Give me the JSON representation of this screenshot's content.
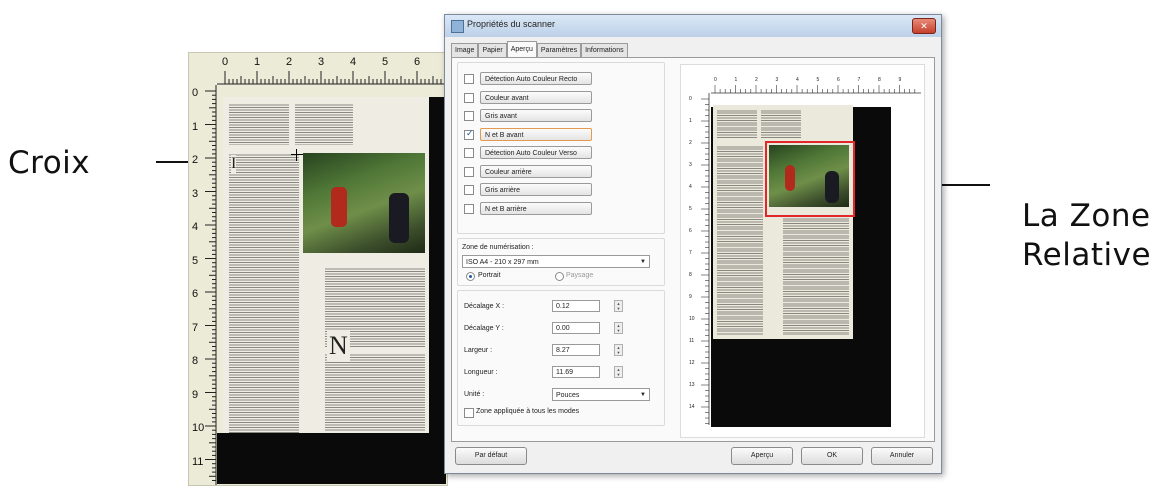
{
  "annotations": {
    "croix": "Croix",
    "zone_line1": "La Zone",
    "zone_line2": "Relative"
  },
  "left_preview": {
    "ruler_h": [
      "0",
      "1",
      "2",
      "3",
      "4",
      "5",
      "6"
    ],
    "ruler_v": [
      "0",
      "1",
      "2",
      "3",
      "4",
      "5",
      "6",
      "7",
      "8",
      "9",
      "10",
      "11"
    ]
  },
  "dialog": {
    "title": "Propriétés du scanner",
    "close_glyph": "✕",
    "tabs": [
      "Image",
      "Papier",
      "Aperçu",
      "Paramètres",
      "Informations"
    ],
    "options": [
      {
        "label": "Détection Auto Couleur Recto",
        "checked": false
      },
      {
        "label": "Couleur avant",
        "checked": false
      },
      {
        "label": "Gris avant",
        "checked": false
      },
      {
        "label": "N et B avant",
        "checked": true
      },
      {
        "label": "Détection Auto Couleur Verso",
        "checked": false
      },
      {
        "label": "Couleur arrière",
        "checked": false
      },
      {
        "label": "Gris arrière",
        "checked": false
      },
      {
        "label": "N et B arrière",
        "checked": false
      }
    ],
    "zone_label": "Zone de numérisation :",
    "zone_value": "ISO A4 - 210 x 297 mm",
    "portrait_label": "Portrait",
    "paysage_label": "Paysage",
    "fields": [
      {
        "label": "Décalage X :",
        "value": "0.12"
      },
      {
        "label": "Décalage Y :",
        "value": "0.00"
      },
      {
        "label": "Largeur :",
        "value": "8.27"
      },
      {
        "label": "Longueur :",
        "value": "11.69"
      }
    ],
    "unit_label": "Unité :",
    "unit_value": "Pouces",
    "apply_all": "Zone appliquée à tous les modes",
    "buttons": {
      "default": "Par défaut",
      "preview": "Aperçu",
      "ok": "OK",
      "cancel": "Annuler"
    },
    "ruler_h": [
      "0",
      "1",
      "2",
      "3",
      "4",
      "5",
      "6",
      "7",
      "8",
      "9"
    ],
    "ruler_v": [
      "0",
      "1",
      "2",
      "3",
      "4",
      "5",
      "6",
      "7",
      "8",
      "9",
      "10",
      "11",
      "12",
      "13",
      "14"
    ]
  }
}
